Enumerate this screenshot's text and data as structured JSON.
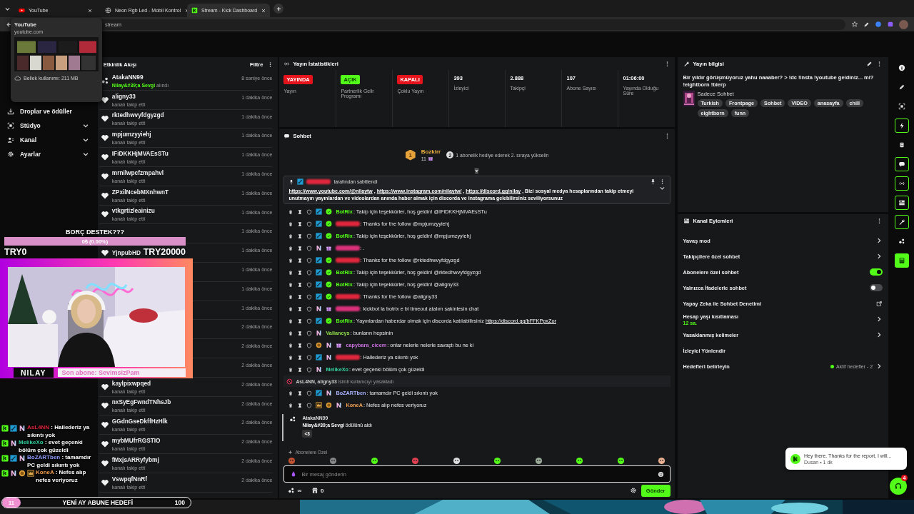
{
  "browser": {
    "tabs": [
      {
        "title": "YouTube",
        "selected": false
      },
      {
        "title": "Neon Rgb Led - Mobil Kontrol",
        "selected": false
      },
      {
        "title": "Stream - Kick Dashboard",
        "selected": true
      }
    ],
    "address": "stream",
    "tab_preview": {
      "title": "YouTube",
      "url": "youtube.com",
      "memory": "Bellek kullanımı: 211 MB"
    }
  },
  "sidebar": {
    "items": [
      {
        "label": "Droplar ve ödüller",
        "expandable": false
      },
      {
        "label": "Stüdyo",
        "expandable": true
      },
      {
        "label": "Kanal",
        "expandable": true
      },
      {
        "label": "Ayarlar",
        "expandable": true
      }
    ]
  },
  "activity": {
    "title": "Etkinlik Akışı",
    "filter": "Filtre",
    "items": [
      {
        "kind": "reward",
        "name": "AtakaNN99",
        "reward": "Nilay&#39;a Sevgi",
        "detail": " alındı",
        "time": "8 saniye önce"
      },
      {
        "kind": "follow",
        "name": "aligny33",
        "detail": "kanalı takip etti",
        "time": "1 dakika önce"
      },
      {
        "kind": "follow",
        "name": "rktedhwvyfdgyzgd",
        "detail": "kanalı takip etti",
        "time": "1 dakika önce"
      },
      {
        "kind": "follow",
        "name": "mpjumzyyiehj",
        "detail": "kanalı takip etti",
        "time": "1 dakika önce"
      },
      {
        "kind": "follow",
        "name": "IFiDKKHjMVAEsSTu",
        "detail": "kanalı takip etti",
        "time": "1 dakika önce"
      },
      {
        "kind": "follow",
        "name": "mrnilwpcfzmpahvl",
        "detail": "kanalı takip etti",
        "time": "1 dakika önce"
      },
      {
        "kind": "follow",
        "name": "ZPxilNcebMXnhwnT",
        "detail": "kanalı takip etti",
        "time": "1 dakika önce"
      },
      {
        "kind": "follow",
        "name": "vtkgrtizleainizu",
        "detail": "kanalı takip etti",
        "time": "1 dakika önce"
      },
      {
        "time": "1 dakika önce"
      },
      {
        "kind": "follow",
        "name": "YjnpubHD",
        "time": "1 dakika önce"
      },
      {
        "time": "1 dakika önce"
      },
      {
        "time": "1 dakika önce"
      },
      {
        "time": "1 dakika önce"
      },
      {
        "time": "2 dakika önce"
      },
      {
        "time": "2 dakika önce"
      },
      {
        "time": "2 dakika önce"
      },
      {
        "kind": "follow",
        "name": "kaylpixwpqed",
        "detail": "kanalı takip etti",
        "time": "2 dakika önce"
      },
      {
        "kind": "follow",
        "name": "nxSyEgFwndTNhsJb",
        "detail": "kanalı takip etti",
        "time": "2 dakika önce"
      },
      {
        "kind": "follow",
        "name": "GGdnGseDkffHzHlk",
        "detail": "kanalı takip etti",
        "time": "2 dakika önce"
      },
      {
        "kind": "follow",
        "name": "mybMUfrRGSTIO",
        "detail": "kanalı takip etti",
        "time": "2 dakika önce"
      },
      {
        "kind": "follow",
        "name": "fMxjsARRyfybmj",
        "detail": "kanalı takip etti",
        "time": "2 dakika önce"
      },
      {
        "kind": "follow",
        "name": "VswpqfNnRf",
        "detail": "kanalı takip etti",
        "time": "2 dakika önce"
      }
    ]
  },
  "stats": {
    "title": "Yayın İstatistikleri",
    "items": [
      {
        "kind": "status",
        "value": "YAYINDA",
        "color": "#e5141c",
        "label": "Yayın"
      },
      {
        "kind": "status",
        "value": "AÇIK",
        "color": "#53fc18",
        "label": "Partnerlik Gelir Programı"
      },
      {
        "kind": "status",
        "value": "KAPALI",
        "color": "#e5141c",
        "label": "Çoklu Yayın"
      },
      {
        "kind": "count",
        "value": "393",
        "label": "İzleyici"
      },
      {
        "kind": "count",
        "value": "2.888",
        "label": "Takipçi"
      },
      {
        "kind": "count",
        "value": "107",
        "label": "Abone Sayısı"
      },
      {
        "kind": "count",
        "value": "01:06:00",
        "label": "Yayında Olduğu Süre"
      }
    ]
  },
  "chat": {
    "title": "Sohbet",
    "leader": {
      "rank": "1",
      "name": "Bozkirr",
      "count": "11",
      "next_rank": "2",
      "hint": "1 abonelik hediye ederek 2. sıraya yükselin"
    },
    "pinned": {
      "color": "#e0263c",
      "note": "tarafından sabitlendi",
      "parts": [
        {
          "link": "https://www.youtube.com/@nilaytw"
        },
        {
          "text": " , "
        },
        {
          "link": "https://www.instagram.com/nilaytw/"
        },
        {
          "text": " , "
        },
        {
          "link": "https://discord.gg/nilay"
        },
        {
          "text": " , Bizi sosyal medya hesaplarından takip etmeyi unutmayın yayınlardan ve videolardan anında haber almak için discorda ve instagrama gelebilirsiniz seviliyorsunuz"
        }
      ]
    },
    "messages": [
      {
        "kind": "message",
        "redacted": false,
        "user": "BotRix",
        "color": "#53fc18",
        "badges": [
          {
            "kind": "mod"
          },
          {
            "kind": "verified"
          }
        ],
        "text": ": Takip için teşekkürler, hoş geldin! @IFiDKKHjMVAEsSTu"
      },
      {
        "kind": "message",
        "redacted": true,
        "color": "#e0263c",
        "badges": [
          {
            "kind": "mod"
          },
          {
            "kind": "verified"
          }
        ],
        "text": ": Thanks for the follow @mpjumzyyiehj"
      },
      {
        "kind": "message",
        "redacted": false,
        "user": "BotRix",
        "color": "#53fc18",
        "badges": [
          {
            "kind": "mod"
          },
          {
            "kind": "verified"
          }
        ],
        "text": ": Takip için teşekkürler, hoş geldin! @mpjumzyyiehj"
      },
      {
        "kind": "message",
        "redacted": true,
        "color": "#d9307a",
        "badges": [
          {
            "kind": "og"
          },
          {
            "kind": "gift"
          }
        ],
        "text": ": ."
      },
      {
        "kind": "message",
        "redacted": true,
        "color": "#e0263c",
        "badges": [
          {
            "kind": "mod"
          },
          {
            "kind": "verified"
          }
        ],
        "text": ": Thanks for the follow @rktedhwvyfdgyzgd"
      },
      {
        "kind": "message",
        "redacted": false,
        "user": "BotRix",
        "color": "#53fc18",
        "badges": [
          {
            "kind": "mod"
          },
          {
            "kind": "verified"
          }
        ],
        "text": ": Takip için teşekkürler, hoş geldin! @rktedhwvyfdgyzgd"
      },
      {
        "kind": "message",
        "redacted": false,
        "user": "BotRix",
        "color": "#53fc18",
        "badges": [
          {
            "kind": "mod"
          },
          {
            "kind": "verified"
          }
        ],
        "text": ": Takip için teşekkürler, hoş geldin! @aligny33"
      },
      {
        "kind": "message",
        "redacted": true,
        "color": "#e0263c",
        "badges": [
          {
            "kind": "mod"
          },
          {
            "kind": "verified"
          }
        ],
        "text": ": Thanks for the follow @aligny33"
      },
      {
        "kind": "message",
        "redacted": true,
        "color": "#d9307a",
        "badges": [
          {
            "kind": "og"
          },
          {
            "kind": "gift"
          }
        ],
        "text": ": kickbot la botrix e bi timeout atalım sakinlesin chat"
      },
      {
        "kind": "message",
        "redacted": false,
        "user": "BotRix",
        "color": "#53fc18",
        "badges": [
          {
            "kind": "mod"
          },
          {
            "kind": "verified"
          }
        ],
        "text": ": Yayınlardan haberdar olmak için discorda katılabilirsiniz",
        "link": "https://discord.gg/bFFKPpxZor"
      },
      {
        "kind": "message",
        "redacted": false,
        "user": "Valiancys",
        "color": "#8fdc4a",
        "badges": [
          {
            "kind": "og"
          }
        ],
        "text": ": bunların hepsinin"
      },
      {
        "kind": "message",
        "redacted": false,
        "user": "capybara_cicem",
        "color": "#c46fd8",
        "badges": [
          {
            "kind": "sub"
          },
          {
            "kind": "og"
          },
          {
            "kind": "gift"
          }
        ],
        "text": ": onlar nelerle nelerle savaştı bu ne ki"
      },
      {
        "kind": "message",
        "redacted": true,
        "color": "#e0263c",
        "badges": [
          {
            "kind": "mod"
          },
          {
            "kind": "og"
          }
        ],
        "text": ": Hallederiz ya sıkıntı yok"
      },
      {
        "kind": "message",
        "redacted": false,
        "user": "MelikeXo",
        "color": "#35d3a0",
        "badges": [
          {
            "kind": "og"
          }
        ],
        "text": ": evet geçenki bölüm çok güzeldi"
      },
      {
        "kind": "ban",
        "users": "AsL4NN, aligny33",
        "text": " isimli kullanıcıyı yasakladı"
      },
      {
        "kind": "message",
        "redacted": false,
        "user": "BoZARTben",
        "color": "#a9b4ff",
        "badges": [
          {
            "kind": "mod"
          },
          {
            "kind": "og"
          }
        ],
        "text": ": tamamdır PC geldi sıkıntı yok"
      },
      {
        "kind": "message",
        "redacted": false,
        "user": "KoneA",
        "color": "#f0a050",
        "badges": [
          {
            "kind": "crown"
          },
          {
            "kind": "sub"
          },
          {
            "kind": "og"
          }
        ],
        "text": ": Nefes alıp nefes veriyoruz"
      },
      {
        "kind": "reward",
        "user": "AtakaNN99",
        "reward": "Nilay&#39;a Sevgi",
        "text": " ödülünü aldı",
        "note": "<3"
      }
    ],
    "input": {
      "section": "Abonelere Özel",
      "placeholder": "Bir mesaj gönderin",
      "points": "∞",
      "store": "0",
      "send": "Gönder"
    }
  },
  "info": {
    "title": "Yayın bilgisi",
    "stream_title": "Bir yıldır görüşmüyoruz yahu naaaber? > !dc !insta !youtube geldiniz... mi? !eightborn !bierp",
    "category": "Sadece Sohbet",
    "tags": [
      "Turkish",
      "Frontpage",
      "Sohbet",
      "VIDEO",
      "anasayfa",
      "chill",
      "eightborn",
      "funn"
    ]
  },
  "actions": {
    "title": "Kanal Eylemleri",
    "items": [
      {
        "kind": "arrow",
        "label": "Yavaş mod"
      },
      {
        "kind": "arrow",
        "label": "Takipçilere özel sohbet"
      },
      {
        "kind": "toggle",
        "label": "Abonelere özel sohbet",
        "on": true
      },
      {
        "kind": "toggle",
        "label": "Yalnızca İfadelerle sohbet",
        "on": false
      },
      {
        "kind": "external",
        "label": "Yapay Zeka ile Sohbet Denetimi"
      },
      {
        "kind": "arrow",
        "label": "Hesap yaşı kısıtlaması",
        "detail": "12 sa."
      },
      {
        "kind": "arrow",
        "label": "Yasaklanmış kelimeler"
      },
      {
        "kind": "plain",
        "label": "İzleyici Yönlendir"
      },
      {
        "kind": "arrow",
        "label": "Hedefleri belirleyin",
        "status": "Aktif hedefler - 2"
      }
    ]
  },
  "rail": {
    "items": [
      {
        "outlined": false,
        "filled": false
      },
      {
        "outlined": false,
        "filled": false
      },
      {
        "outlined": false,
        "filled": false
      },
      {
        "outlined": true,
        "filled": false
      },
      {
        "outlined": false,
        "filled": false
      },
      {
        "outlined": true,
        "filled": false
      },
      {
        "outlined": true,
        "filled": false
      },
      {
        "outlined": true,
        "filled": false
      },
      {
        "outlined": true,
        "filled": false
      },
      {
        "outlined": false,
        "filled": false
      },
      {
        "outlined": false,
        "filled": true
      }
    ]
  },
  "overlay": {
    "goal": {
      "title": "BORÇ DESTEK???",
      "progress": "0₺ (0.00%)",
      "level": 0,
      "min": "TRY0",
      "max": "TRY20000"
    },
    "camera": {
      "name": "NILAY",
      "last_sub": "Son abone: SevimsizPam"
    },
    "chat": [
      {
        "user": "AsL4NN",
        "color": "#e0263c",
        "badges": [
          {
            "kind": "kick"
          },
          {
            "kind": "mod"
          },
          {
            "kind": "og"
          }
        ],
        "text": " : Hallederiz ya sıkıntı yok"
      },
      {
        "user": "MelikeXo",
        "color": "#35d3a0",
        "badges": [
          {
            "kind": "kick"
          },
          {
            "kind": "og"
          }
        ],
        "text": " : evet geçenki bölüm çok güzeldi"
      },
      {
        "user": "BoZARTben",
        "color": "#8f9cff",
        "badges": [
          {
            "kind": "kick"
          },
          {
            "kind": "mod"
          },
          {
            "kind": "og"
          }
        ],
        "text": " : tamamdır PC geldi sıkıntı yok"
      },
      {
        "user": "KoneA",
        "color": "#f0a050",
        "badges": [
          {
            "kind": "kick"
          },
          {
            "kind": "og"
          },
          {
            "kind": "sub"
          },
          {
            "kind": "crown"
          }
        ],
        "text": " : Nefes alıp nefes veriyoruz"
      }
    ],
    "sub_goal": {
      "count": "11",
      "title": "YENİ AY ABUNE HEDEFİ",
      "target": "100"
    }
  },
  "support": {
    "message": "Hey there. Thanks for the report, I will...",
    "meta": "Dusan • 1 dk",
    "badge": "4"
  }
}
